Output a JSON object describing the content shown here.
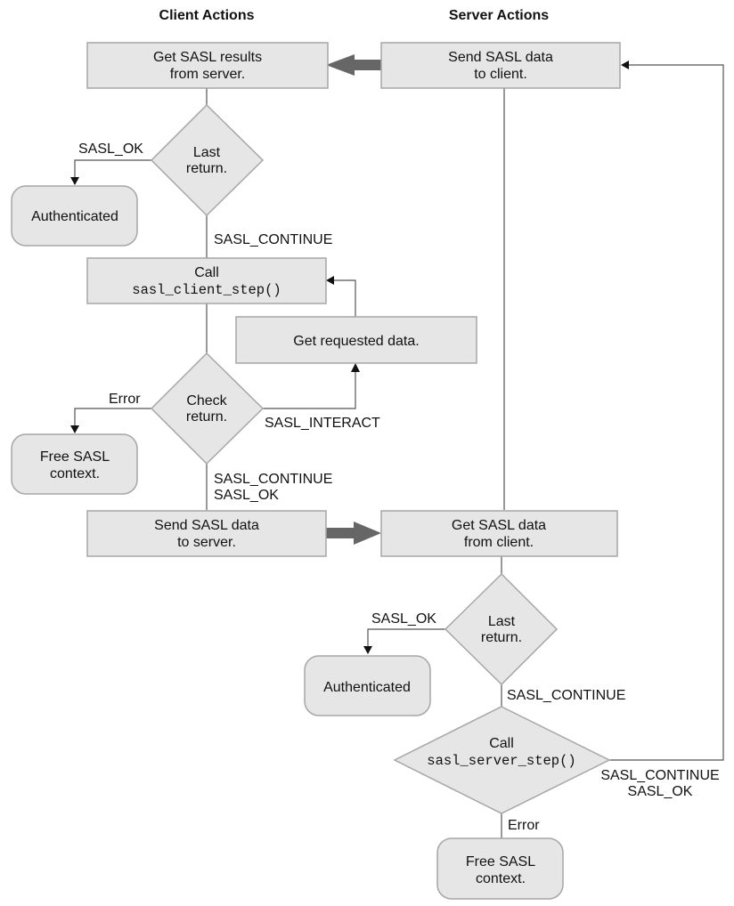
{
  "headings": {
    "client": "Client Actions",
    "server": "Server Actions"
  },
  "nodes": {
    "get_results": {
      "line1": "Get SASL results",
      "line2": "from server."
    },
    "send_to_client": {
      "line1": "Send SASL data",
      "line2": "to client."
    },
    "client_last_return": {
      "line1": "Last",
      "line2": "return."
    },
    "client_authenticated": {
      "label": "Authenticated"
    },
    "call_client_step": {
      "line1": "Call",
      "line2": "sasl_client_step()"
    },
    "get_requested": {
      "label": "Get requested data."
    },
    "check_return": {
      "line1": "Check",
      "line2": "return."
    },
    "client_free": {
      "line1": "Free SASL",
      "line2": "context."
    },
    "send_to_server": {
      "line1": "Send SASL data",
      "line2": "to server."
    },
    "get_from_client": {
      "line1": "Get SASL data",
      "line2": "from client."
    },
    "server_last_return": {
      "line1": "Last",
      "line2": "return."
    },
    "server_authenticated": {
      "label": "Authenticated"
    },
    "call_server_step": {
      "line1": "Call",
      "line2": "sasl_server_step()"
    },
    "server_free": {
      "line1": "Free SASL",
      "line2": "context."
    }
  },
  "edge_labels": {
    "client_ok": "SASL_OK",
    "client_continue": "SASL_CONTINUE",
    "client_error": "Error",
    "client_interact": "SASL_INTERACT",
    "client_continue2_line1": "SASL_CONTINUE",
    "client_continue2_line2": "SASL_OK",
    "server_ok": "SASL_OK",
    "server_continue": "SASL_CONTINUE",
    "server_loop_line1": "SASL_CONTINUE",
    "server_loop_line2": "SASL_OK",
    "server_error": "Error"
  }
}
